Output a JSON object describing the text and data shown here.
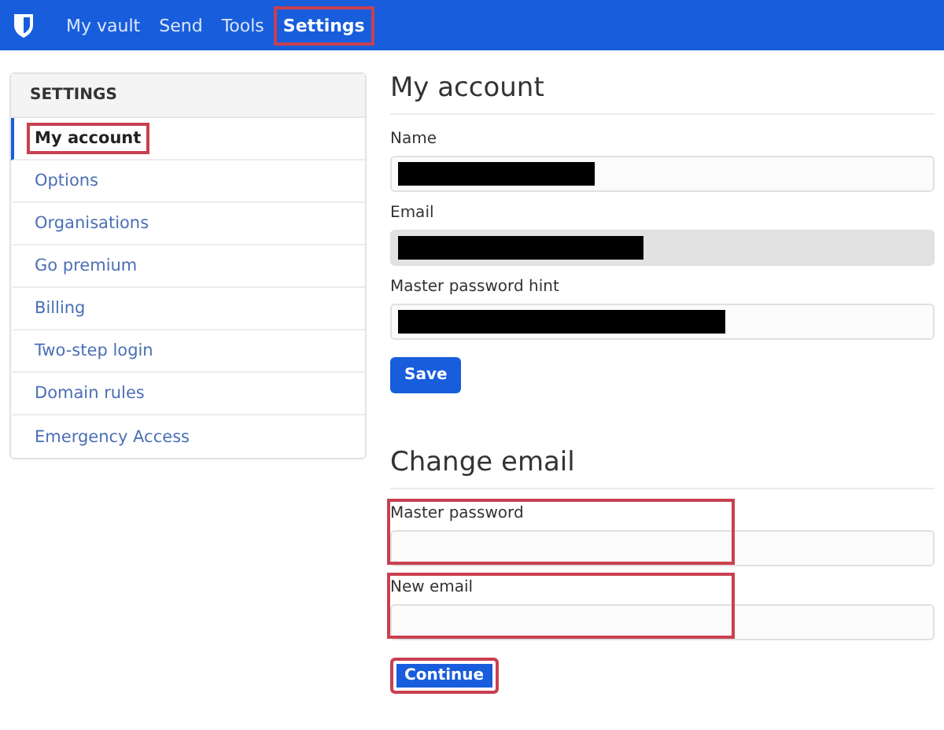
{
  "nav": {
    "items": [
      {
        "label": "My vault",
        "selected": false,
        "highlighted": false
      },
      {
        "label": "Send",
        "selected": false,
        "highlighted": false
      },
      {
        "label": "Tools",
        "selected": false,
        "highlighted": false
      },
      {
        "label": "Settings",
        "selected": true,
        "highlighted": true
      }
    ]
  },
  "sidebar": {
    "title": "SETTINGS",
    "items": [
      {
        "label": "My account",
        "selected": true,
        "highlighted": true
      },
      {
        "label": "Options",
        "selected": false,
        "highlighted": false
      },
      {
        "label": "Organisations",
        "selected": false,
        "highlighted": false
      },
      {
        "label": "Go premium",
        "selected": false,
        "highlighted": false
      },
      {
        "label": "Billing",
        "selected": false,
        "highlighted": false
      },
      {
        "label": "Two-step login",
        "selected": false,
        "highlighted": false
      },
      {
        "label": "Domain rules",
        "selected": false,
        "highlighted": false
      },
      {
        "label": "Emergency Access",
        "selected": false,
        "highlighted": false
      }
    ]
  },
  "my_account": {
    "heading": "My account",
    "fields": [
      {
        "label": "Name",
        "redacted": true,
        "disabled": false,
        "highlighted": false
      },
      {
        "label": "Email",
        "redacted": true,
        "disabled": true,
        "highlighted": false
      },
      {
        "label": "Master password hint",
        "redacted": true,
        "disabled": false,
        "highlighted": false
      }
    ],
    "button": {
      "label": "Save",
      "highlighted": false
    }
  },
  "change_email": {
    "heading": "Change email",
    "fields": [
      {
        "label": "Master password",
        "redacted": false,
        "disabled": false,
        "highlighted": true
      },
      {
        "label": "New email",
        "redacted": false,
        "disabled": false,
        "highlighted": true
      }
    ],
    "button": {
      "label": "Continue",
      "highlighted": true
    }
  }
}
